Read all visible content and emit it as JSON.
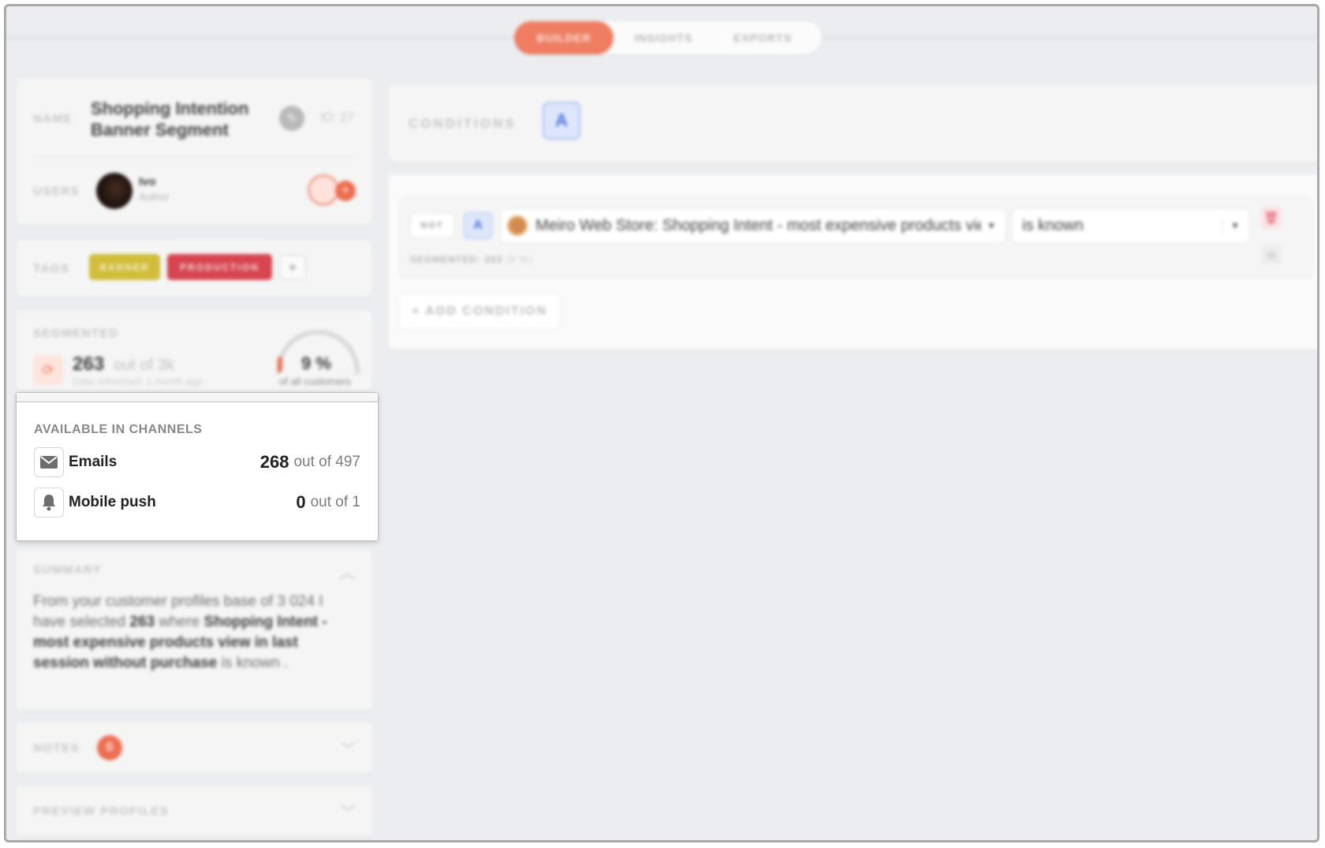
{
  "tabs": [
    {
      "label": "BUILDER",
      "active": true
    },
    {
      "label": "INSIGHTS",
      "active": false
    },
    {
      "label": "EXPORTS",
      "active": false
    }
  ],
  "segment": {
    "name_label": "NAME",
    "name": "Shopping Intention Banner Segment",
    "id": "ID: 27",
    "users_label": "USERS",
    "user_name": "Ivo",
    "user_role": "Author"
  },
  "tags": {
    "label": "TAGS",
    "items": [
      "BANNER",
      "PRODUCTION"
    ],
    "add": "+"
  },
  "segmented": {
    "label": "SEGMENTED",
    "count": "263",
    "out_of": "out of 3k",
    "refreshed": "Data refreshed: 1 month ago",
    "percent": "9 %",
    "percent_caption": "of all customers",
    "fraction": 0.09
  },
  "channels": {
    "title": "AVAILABLE IN CHANNELS",
    "items": [
      {
        "name": "Emails",
        "icon": "envelope-icon",
        "value": "268",
        "out_of": "out of 497"
      },
      {
        "name": "Mobile push",
        "icon": "bell-icon",
        "value": "0",
        "out_of": "out of 1"
      }
    ]
  },
  "summary": {
    "label": "SUMMARY",
    "text_1": "From your customer profiles base of 3 024 I have selected ",
    "count": "263",
    "text_2": " where ",
    "attribute": "Shopping Intent - most expensive products view in last session without purchase",
    "text_3": " is known ."
  },
  "notes": {
    "label": "NOTES",
    "count": "0"
  },
  "preview": {
    "label": "PREVIEW PROFILES"
  },
  "conditions": {
    "label": "CONDITIONS",
    "group": "A",
    "row": {
      "not": "NOT",
      "group": "A",
      "attribute": "Meiro Web Store: Shopping Intent - most expensive products view in last session without purchase",
      "operator": "is known",
      "segmented_label": "SEGMENTED:",
      "segmented_count": "263",
      "segmented_pct": "(9 %)"
    },
    "add_label": "+ ADD CONDITION"
  },
  "colors": {
    "accent": "#ee7d62",
    "tag_banner": "#d1bd3a",
    "tag_production": "#d64550",
    "condition_blue": "#4b73de"
  }
}
